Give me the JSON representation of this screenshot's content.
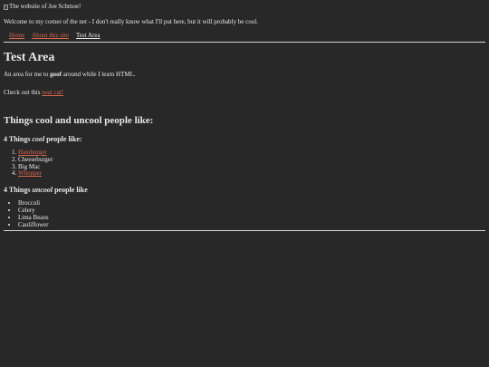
{
  "header": {
    "image_alt": "The website of Joe Schmoe!",
    "welcome": "Welcome to my corner of the net - I don't really know what I'll put here, but it will probably be cool."
  },
  "nav": {
    "items": [
      {
        "label": "Home",
        "color": "#d9674b"
      },
      {
        "label": "About this site",
        "color": "#d9674b"
      },
      {
        "label": "Test Area",
        "color": "#e8e8e8"
      }
    ]
  },
  "main": {
    "title": "Test Area",
    "intro_prefix": "An area for me to ",
    "intro_bold": "goof",
    "intro_suffix": " around while I learn HTML.",
    "checkout_prefix": "Check out this ",
    "checkout_link": "neat cat!",
    "section_title": "Things cool and uncool people like:",
    "cool": {
      "heading_prefix": "4 Things ",
      "heading_emph": "cool",
      "heading_suffix": " people like:",
      "items": [
        "Hamburger",
        "Cheeseburger",
        "Big Mac",
        "Whopper"
      ]
    },
    "uncool": {
      "heading_prefix": "4 Things ",
      "heading_emph": "uncool",
      "heading_suffix": " people like",
      "items": [
        "Broccoli",
        "Celery",
        "Lima Beans",
        "Cauliflower"
      ]
    }
  },
  "colors": {
    "background": "#282828",
    "text": "#e8e8e8",
    "link": "#d9674b"
  }
}
